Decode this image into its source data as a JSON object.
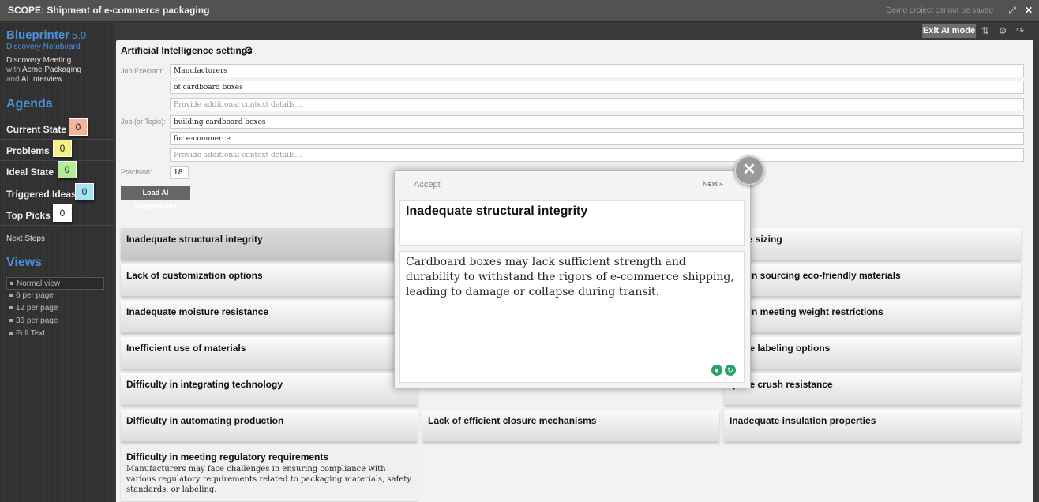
{
  "window": {
    "title": "SCOPE: Shipment of e-commerce packaging",
    "demo_notice": "Demo project cannot be saved",
    "expand_icon": "expand-icon",
    "close_icon": "close-icon"
  },
  "sidebar": {
    "brand": "Blueprinter",
    "version": "5.0",
    "subtitle": "Discovery Noteboard",
    "meeting_line1": "Discovery Meeting",
    "meeting_with": "with",
    "meeting_company": "Acme Packaging",
    "meeting_and": "and",
    "meeting_interview": "AI Interview",
    "agenda_heading": "Agenda",
    "agenda": [
      {
        "label": "Current State",
        "count": "0",
        "color": "#f7b49a"
      },
      {
        "label": "Problems",
        "count": "0",
        "color": "#f6ef86"
      },
      {
        "label": "Ideal State",
        "count": "0",
        "color": "#b5ec9a"
      },
      {
        "label": "Triggered Ideas",
        "count": "0",
        "color": "#a6e2f2"
      },
      {
        "label": "Top Picks",
        "count": "0",
        "color": "#ffffff"
      }
    ],
    "next_steps": "Next Steps",
    "views_heading": "Views",
    "views": [
      "Normal view",
      "6 per page",
      "12 per page",
      "36 per page",
      "Full Text"
    ],
    "active_view": "Normal view"
  },
  "toolbar": {
    "exit_ai": "Exit AI mode",
    "icons": [
      "sort-icon",
      "settings-icon",
      "share-icon"
    ]
  },
  "ai_settings": {
    "title": "Artificial Intelligence settings",
    "job_executor_label": "Job Executor:",
    "job_executor": "Manufacturers",
    "job_executor_detail": "of cardboard boxes",
    "job_executor_context_placeholder": "Provide additional context details...",
    "job_topic_label": "Job (or Topic):",
    "job_topic": "building cardboard boxes",
    "job_topic_detail": "for e-commerce",
    "job_topic_context_placeholder": "Provide additional context details...",
    "precision_label": "Precision:",
    "precision": "18",
    "load_button": "Load AI Suggestions"
  },
  "suggestions": {
    "col1": [
      "Inadequate structural integrity",
      "Lack of customization options",
      "Inadequate moisture resistance",
      "Inefficient use of materials",
      "Difficulty in integrating technology",
      "Difficulty in automating production"
    ],
    "col2": [
      "Lack of efficient closure mechanisms"
    ],
    "col3": [
      "urate sizing",
      "ulty in sourcing eco-friendly materials",
      "ulty in meeting weight restrictions",
      "quate labeling options",
      "quate crush resistance",
      "Inadequate insulation properties"
    ],
    "expanded": {
      "title": "Difficulty in meeting regulatory requirements",
      "description": "Manufacturers may face challenges in ensuring compliance with various regulatory requirements related to packaging materials, safety standards, or labeling."
    }
  },
  "modal": {
    "accept": "Accept",
    "next": "Next »",
    "title": "Inadequate structural integrity",
    "description": "Cardboard boxes may lack sufficient strength and durability to withstand the rigors of e-commerce shipping, leading to damage or collapse during transit.",
    "icons": [
      "location-pin-icon",
      "refresh-icon"
    ]
  }
}
